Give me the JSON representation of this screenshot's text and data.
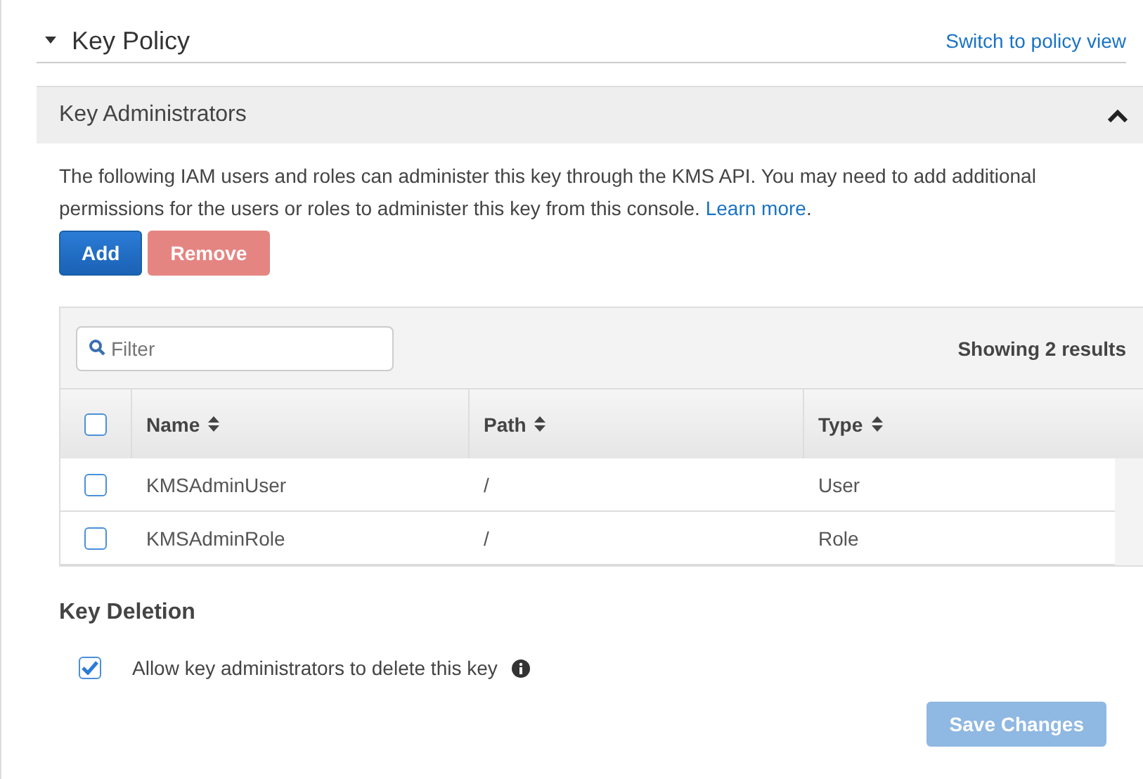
{
  "section": {
    "title": "Key Policy",
    "expanded": true,
    "link": "Switch to policy view"
  },
  "panel": {
    "title": "Key Administrators",
    "expanded": true,
    "description": "The following IAM users and roles can administer this key through the KMS API. You may need to add additional permissions for the users or roles to administer this key from this console.",
    "learn_more": "Learn more",
    "after_link": ".",
    "buttons": [
      {
        "label": "Add",
        "kind": "primary",
        "disabled": false
      },
      {
        "label": "Remove",
        "kind": "danger",
        "disabled": true
      }
    ],
    "table": {
      "filter": {
        "placeholder": "Filter"
      },
      "count": "Showing 2 results",
      "all_checked": false,
      "columns": [
        "Name",
        "Path",
        "Type"
      ],
      "rows": [
        {
          "checked": false,
          "cells": [
            "KMSAdminUser",
            "/",
            "User"
          ]
        },
        {
          "checked": false,
          "cells": [
            "KMSAdminRole",
            "/",
            "Role"
          ]
        }
      ]
    },
    "deletion": {
      "title": "Key Deletion",
      "option": "Allow key administrators to delete this key",
      "checked": true
    },
    "save": {
      "label": "Save Changes",
      "disabled": true
    }
  }
}
